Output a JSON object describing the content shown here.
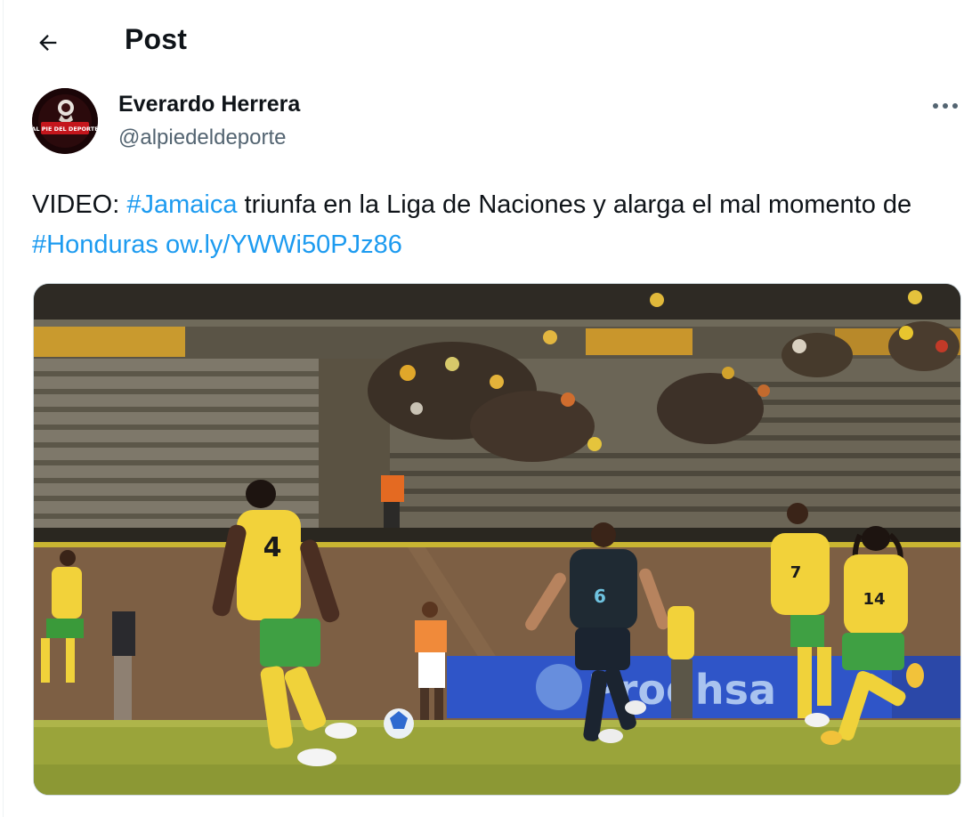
{
  "header": {
    "title": "Post"
  },
  "icons": {
    "back": "arrow-left-icon",
    "more": "more-horizontal-icon"
  },
  "author": {
    "name": "Everardo Herrera",
    "handle": "@alpiedeldeporte",
    "avatar_logo_text": "AL PIE DEL DEPORTE"
  },
  "tweet": {
    "prefix": "VIDEO: ",
    "hashtag1": "#Jamaica",
    "middle": " triunfa en la Liga de Naciones y alarga el mal momento de ",
    "hashtag2": "#Honduras",
    "space": " ",
    "link": "ow.ly/YWWi50PJz86"
  },
  "media": {
    "type": "photo",
    "banner_text": "Prodhsa",
    "players": [
      {
        "team": "Jamaica",
        "number": "4"
      },
      {
        "team": "Honduras",
        "number": "6"
      },
      {
        "team": "Jamaica",
        "number": "7"
      },
      {
        "team": "Jamaica",
        "number": "14"
      }
    ]
  },
  "colors": {
    "link": "#1d9bf0",
    "text": "#0f1419",
    "secondary": "#536471",
    "jamaica_kit": "#f2d23a",
    "honduras_kit": "#1f2a33"
  }
}
